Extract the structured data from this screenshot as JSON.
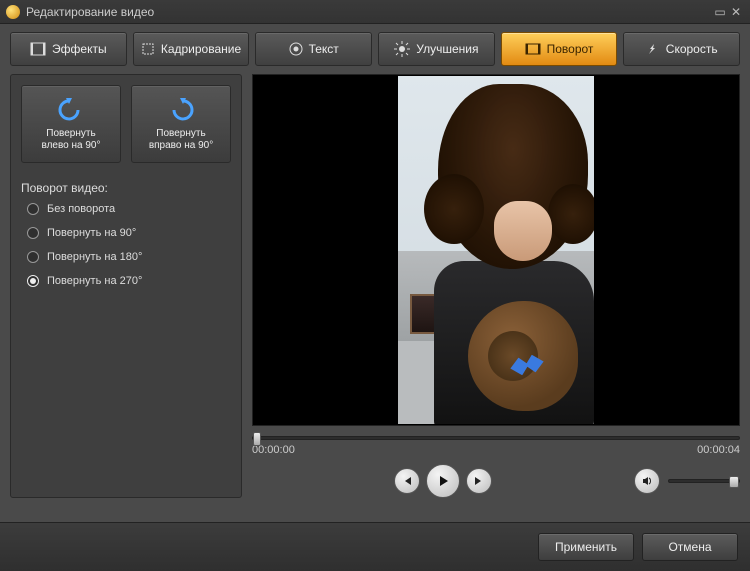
{
  "window": {
    "title": "Редактирование видео"
  },
  "tabs": [
    {
      "label": "Эффекты"
    },
    {
      "label": "Кадрирование"
    },
    {
      "label": "Текст"
    },
    {
      "label": "Улучшения"
    },
    {
      "label": "Поворот",
      "active": true
    },
    {
      "label": "Скорость"
    }
  ],
  "rotate_buttons": {
    "left": {
      "line1": "Повернуть",
      "line2": "влево  на 90°"
    },
    "right": {
      "line1": "Повернуть",
      "line2": "вправо на 90°"
    }
  },
  "rotation_section_label": "Поворот видео:",
  "rotation_options": [
    {
      "label": "Без поворота",
      "selected": false
    },
    {
      "label": "Повернуть на 90°",
      "selected": false
    },
    {
      "label": "Повернуть на 180°",
      "selected": false
    },
    {
      "label": "Повернуть на 270°",
      "selected": true
    }
  ],
  "player": {
    "time_start": "00:00:00",
    "time_end": "00:00:04"
  },
  "footer": {
    "apply": "Применить",
    "cancel": "Отмена"
  }
}
